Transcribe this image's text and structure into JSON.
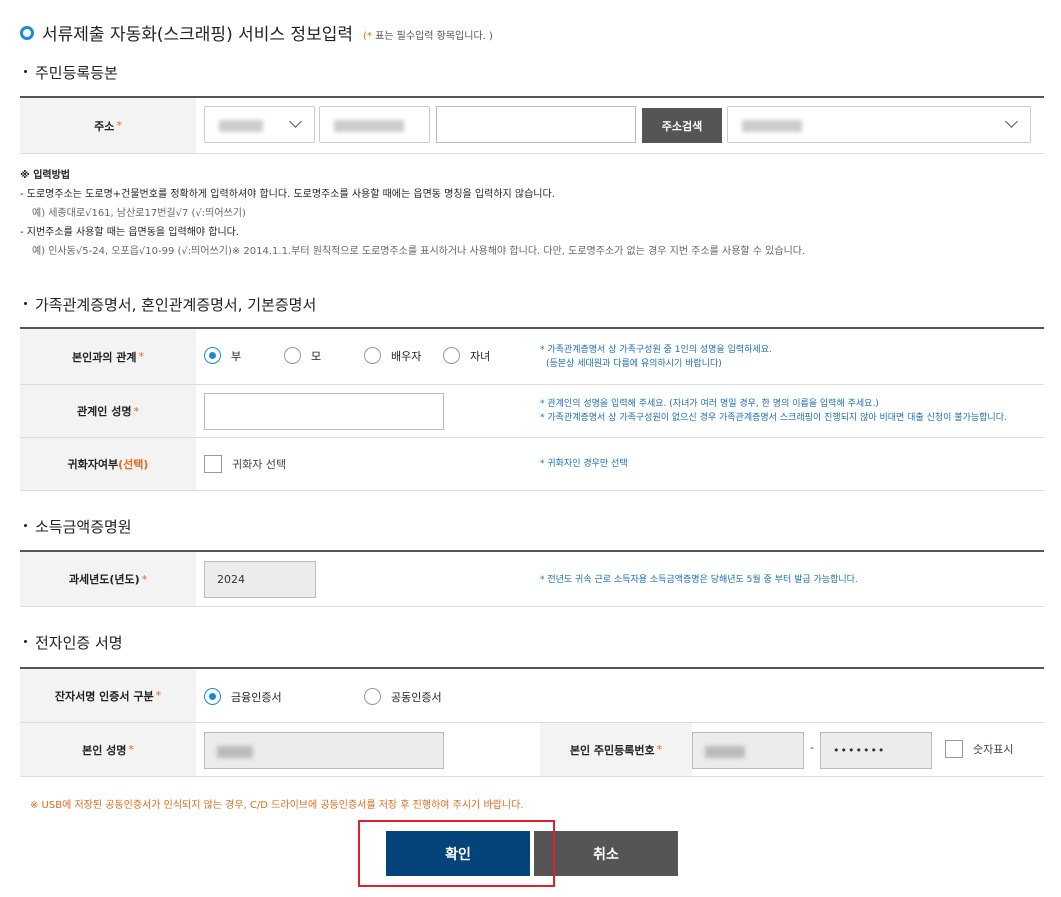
{
  "header": {
    "title": "서류제출 자동화(스크래핑) 서비스 정보입력",
    "note_star": "(*",
    "note_text": " 표는 필수입력 항목입니다. )"
  },
  "sections": {
    "resident": "주민등록등본",
    "family": "가족관계증명서, 혼인관계증명서, 기본증명서",
    "income": "소득금액증명원",
    "esign": "전자인증 서명"
  },
  "address": {
    "label": "주소",
    "req": "*",
    "search_button": "주소검색"
  },
  "guide": {
    "head": "※ 입력방법",
    "line1": "- 도로명주소는 도로명+건물번호를 정확하게 입력하셔야 합니다. 도로명주소를 사용할 때에는 읍면동 명칭을 입력하지 않습니다.",
    "ex1": "예) 세종대로√161, 남산로17번길√7 (√:띄어쓰기)",
    "line2": "- 지번주소를 사용할 때는 읍면동을 입력해야 합니다.",
    "ex2": "예) 인사동√5-24, 오포읍√10-99 (√:띄어쓰기)※ 2014.1.1.부터 원칙적으로 도로명주소를 표시하거나 사용해야 합니다. 다만, 도로명주소가 없는 경우 지번 주소를 사용할 수 있습니다."
  },
  "relation": {
    "label": "본인과의 관계",
    "req": "*",
    "options": [
      "부",
      "모",
      "배우자",
      "자녀"
    ],
    "selected": "부",
    "help1": "* 가족관계증명서 상 가족구성원 중 1인의 성명을 입력하세요.",
    "help2": "(등본상 세대원과 다름에 유의하시기 바랍니다)"
  },
  "relative_name": {
    "label": "관계인 성명",
    "req": "*",
    "value": "",
    "help1": "* 관계인의 성명을 입력해 주세요. (자녀가 여러 명일 경우, 한 명의 이름을 입력해 주세요.)",
    "help2": "* 가족관계증명서 상 가족구성원이 없으신 경우 가족관계증명서 스크래핑이 진행되지 않아 비대면 대출 신청이 불가능합니다."
  },
  "naturalized": {
    "label": "귀화자여부",
    "opt": "(선택)",
    "checkbox_label": "귀화자 선택",
    "help": "*  귀화자인 경우만 선택"
  },
  "tax_year": {
    "label": "과세년도(년도)",
    "req": "*",
    "value": "2024",
    "help": "* 전년도 귀속 근로 소득자용 소득금액증명은 당해년도 5월 중 부터 발급 가능합니다."
  },
  "cert_type": {
    "label": "잔자서명 인증서 구분",
    "req": "*",
    "options": [
      "금융인증서",
      "공동인증서"
    ],
    "selected": "금융인증서"
  },
  "identity": {
    "name_label": "본인 성명",
    "name_req": "*",
    "rrn_label": "본인 주민등록번호",
    "rrn_req": "*",
    "rrn_dash": "-",
    "rrn_back": "•••••••",
    "show_digits": "숫자표시"
  },
  "warning": "※ USB에 저장된 공동인증서가 인식되지 않는 경우, C/D 드라이브에 공동인증서를 저장 후 진행하여 주시기 바랍니다.",
  "buttons": {
    "confirm": "확인",
    "cancel": "취소"
  },
  "colors": {
    "accent": "#1a8ad4",
    "required": "#e06b1c",
    "confirm_bg": "#05447a",
    "cancel_bg": "#555555",
    "highlight": "#e0202a"
  }
}
